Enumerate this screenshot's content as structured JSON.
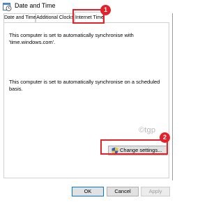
{
  "window": {
    "title": "Date and Time",
    "icon": "clock-calendar-icon"
  },
  "tabs": [
    {
      "label": "Date and Time",
      "selected": false
    },
    {
      "label": "Additional Clocks",
      "selected": false
    },
    {
      "label": "Internet Time",
      "selected": true
    }
  ],
  "panel": {
    "sync_status": "This computer is set to automatically synchronise with 'time.windows.com'.",
    "schedule_status": "This computer is set to automatically synchronise on a scheduled basis.",
    "change_settings_label": "Change settings...",
    "watermark": "©tgp"
  },
  "buttons": {
    "ok_label": "OK",
    "cancel_label": "Cancel",
    "apply_label": "Apply"
  },
  "callouts": [
    {
      "number": "1"
    },
    {
      "number": "2"
    }
  ],
  "colors": {
    "highlight": "#e32128",
    "focus_border": "#0078d7"
  }
}
